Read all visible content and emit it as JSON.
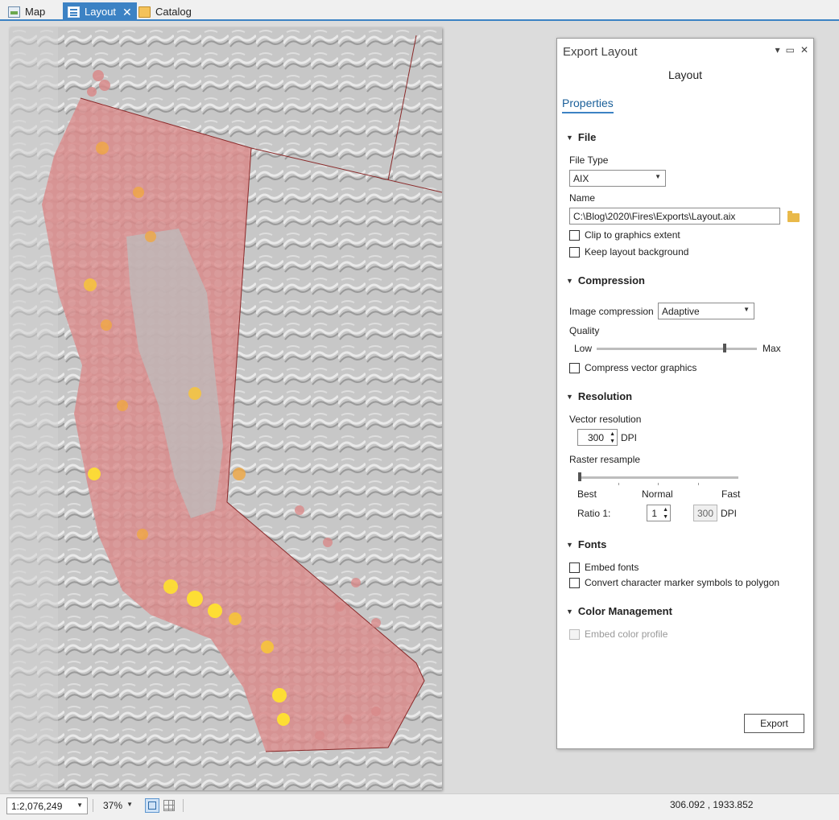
{
  "tabs": [
    {
      "label": "Map",
      "icon": "map-icon",
      "active": false
    },
    {
      "label": "Layout",
      "icon": "layout-icon",
      "active": true
    },
    {
      "label": "Catalog",
      "icon": "catalog-icon",
      "active": false
    }
  ],
  "export_panel": {
    "title": "Export Layout",
    "subtitle": "Layout",
    "tab": "Properties",
    "file": {
      "section": "File",
      "file_type_label": "File Type",
      "file_type_value": "AIX",
      "name_label": "Name",
      "name_value": "C:\\Blog\\2020\\Fires\\Exports\\Layout.aix",
      "clip_label": "Clip to graphics extent",
      "keep_bg_label": "Keep layout background"
    },
    "compression": {
      "section": "Compression",
      "image_compression_label": "Image compression",
      "image_compression_value": "Adaptive",
      "quality_label": "Quality",
      "low_label": "Low",
      "max_label": "Max",
      "quality_level": 0.8,
      "compress_vector_label": "Compress vector graphics"
    },
    "resolution": {
      "section": "Resolution",
      "vector_resolution_label": "Vector resolution",
      "vector_resolution_value": "300",
      "dpi_label": "DPI",
      "raster_resample_label": "Raster resample",
      "raster_resample_level": 0,
      "best_label": "Best",
      "normal_label": "Normal",
      "fast_label": "Fast",
      "ratio_label": "Ratio 1:",
      "ratio_value": "1",
      "ratio_dpi_value": "300",
      "ratio_dpi_label": "DPI"
    },
    "fonts": {
      "section": "Fonts",
      "embed_fonts_label": "Embed fonts",
      "convert_markers_label": "Convert character marker symbols to polygon"
    },
    "color_management": {
      "section": "Color Management",
      "embed_profile_label": "Embed color profile"
    },
    "export_button": "Export"
  },
  "statusbar": {
    "scale": "1:2,076,249",
    "zoom": "37%",
    "coordinates": "306.092 , 1933.852"
  },
  "colors": {
    "accent": "#3c82c4",
    "hex_low": "#d98a8a",
    "hex_mid": "#f0a742",
    "hex_high": "#ffe12e"
  }
}
